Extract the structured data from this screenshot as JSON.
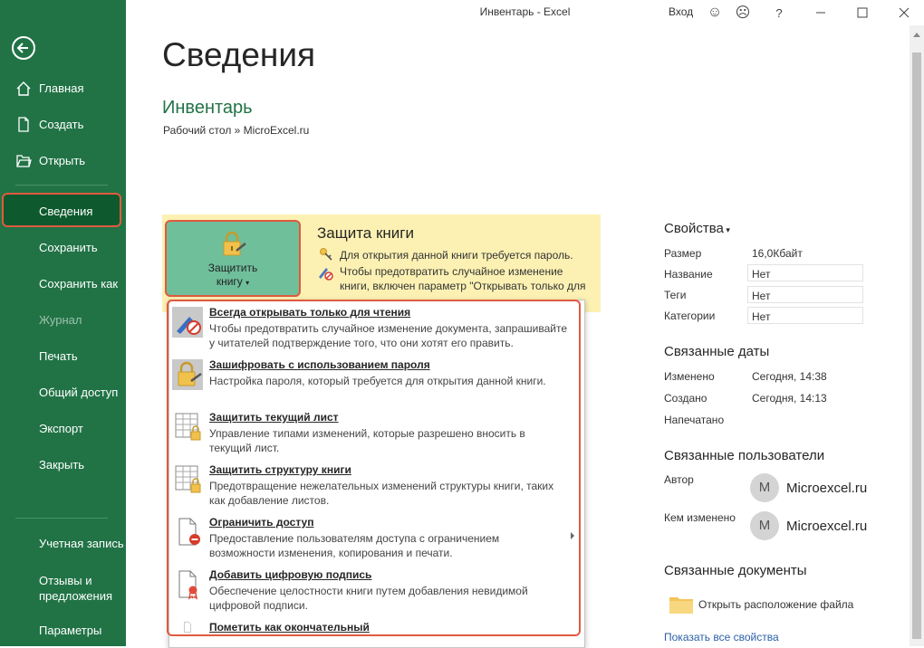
{
  "window": {
    "title": "Инвентарь  -  Excel",
    "login": "Вход"
  },
  "sidebar": {
    "items": [
      {
        "label": "Главная"
      },
      {
        "label": "Создать"
      },
      {
        "label": "Открыть"
      },
      {
        "label": "Сведения",
        "selected": true
      },
      {
        "label": "Сохранить"
      },
      {
        "label": "Сохранить как"
      },
      {
        "label": "Журнал",
        "disabled": true
      },
      {
        "label": "Печать"
      },
      {
        "label": "Общий доступ"
      },
      {
        "label": "Экспорт"
      },
      {
        "label": "Закрыть"
      }
    ],
    "bottom": [
      {
        "label": "Учетная запись"
      },
      {
        "label_line1": "Отзывы и",
        "label_line2": "предложения"
      },
      {
        "label": "Параметры"
      }
    ]
  },
  "main": {
    "page_title": "Сведения",
    "doc_name": "Инвентарь",
    "doc_path": "Рабочий стол » MicroExcel.ru"
  },
  "protection": {
    "button_line1": "Защитить",
    "button_line2": "книгу",
    "title": "Защита книги",
    "line1": "Для открытия данной книги требуется пароль.",
    "line2": "Чтобы предотвратить случайное изменение",
    "line3": "книги, включен параметр \"Открывать только для"
  },
  "menu": {
    "items": [
      {
        "title": "Всегда открывать только для чтения",
        "desc": "Чтобы предотвратить случайное изменение документа, запрашивайте у читателей подтверждение того, что они хотят его править."
      },
      {
        "title": "Зашифровать с использованием пароля",
        "desc": "Настройка пароля, который требуется для открытия данной книги."
      },
      {
        "title": "Защитить текущий лист",
        "desc": "Управление типами изменений, которые разрешено вносить в текущий лист."
      },
      {
        "title": "Защитить структуру книги",
        "desc": "Предотвращение нежелательных изменений структуры книги, таких как добавление листов."
      },
      {
        "title": "Ограничить доступ",
        "desc": "Предоставление пользователям доступа с ограничением возможности изменения, копирования и печати."
      },
      {
        "title": "Добавить цифровую подпись",
        "desc": "Обеспечение целостности книги путем добавления невидимой цифровой подписи."
      },
      {
        "title": "Пометить как окончательный",
        "desc": ""
      }
    ]
  },
  "properties": {
    "title": "Свойства",
    "rows": [
      {
        "key": "Размер",
        "value": "16,0Кбайт"
      },
      {
        "key": "Название",
        "value": "Нет"
      },
      {
        "key": "Теги",
        "value": "Нет"
      },
      {
        "key": "Категории",
        "value": "Нет"
      }
    ]
  },
  "dates": {
    "title": "Связанные даты",
    "rows": [
      {
        "key": "Изменено",
        "value": "Сегодня, 14:38"
      },
      {
        "key": "Создано",
        "value": "Сегодня, 14:13"
      },
      {
        "key": "Напечатано",
        "value": ""
      }
    ]
  },
  "users": {
    "title": "Связанные пользователи",
    "author_label": "Автор",
    "author_initial": "M",
    "author_name": "Microexcel.ru",
    "modified_label": "Кем изменено",
    "modified_initial": "M",
    "modified_name": "Microexcel.ru"
  },
  "documents": {
    "title": "Связанные документы",
    "open_location": "Открыть расположение файла",
    "show_all": "Показать все свойства"
  },
  "colors": {
    "accent_green": "#217346",
    "highlight": "#e05a3f",
    "protection_bg": "#fcf1b3"
  }
}
